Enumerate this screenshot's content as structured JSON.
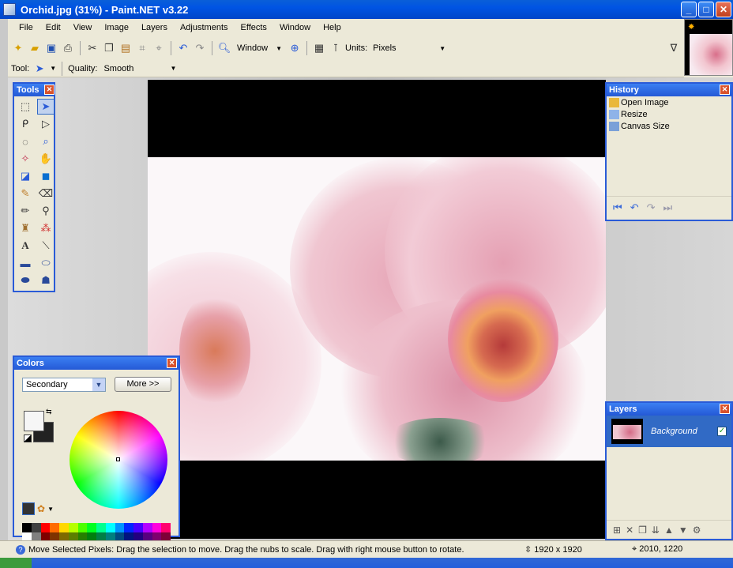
{
  "window": {
    "title": "Orchid.jpg (31%) - Paint.NET v3.22",
    "controls": [
      "minimize",
      "maximize",
      "close"
    ]
  },
  "menu": [
    "File",
    "Edit",
    "View",
    "Image",
    "Layers",
    "Adjustments",
    "Effects",
    "Window",
    "Help"
  ],
  "toolbar": {
    "zoom_value": "Window",
    "units_label": "Units:",
    "units_value": "Pixels",
    "tool_label": "Tool:",
    "quality_label": "Quality:",
    "quality_value": "Smooth"
  },
  "tools_panel": {
    "title": "Tools",
    "tools": [
      "rectangle-select",
      "move-selection",
      "lasso-select",
      "move-selected",
      "ellipse-select",
      "zoom",
      "magic-wand",
      "pan",
      "paint-bucket",
      "gradient",
      "paintbrush",
      "eraser",
      "pencil",
      "color-picker",
      "clone-stamp",
      "recolor",
      "text",
      "line-curve",
      "rectangle",
      "rounded-rectangle",
      "ellipse",
      "freeform-shape"
    ]
  },
  "history_panel": {
    "title": "History",
    "items": [
      "Open Image",
      "Resize",
      "Canvas Size"
    ]
  },
  "colors_panel": {
    "title": "Colors",
    "selector_value": "Secondary",
    "more_button": "More >>",
    "primary_color": "#f6f6f6",
    "secondary_color": "#222222"
  },
  "layers_panel": {
    "title": "Layers",
    "layers": [
      {
        "name": "Background",
        "visible": true
      }
    ]
  },
  "status": {
    "message": "Move Selected Pixels: Drag the selection to move. Drag the nubs to scale. Drag with right mouse button to rotate.",
    "image_size": "1920 x 1920",
    "cursor_pos": "2010, 1220"
  },
  "palette": [
    "#000000",
    "#404040",
    "#ff0000",
    "#ff6a00",
    "#ffd800",
    "#b6ff00",
    "#4cff00",
    "#00ff21",
    "#00ff90",
    "#00ffff",
    "#0094ff",
    "#0026ff",
    "#4800ff",
    "#b200ff",
    "#ff00dc",
    "#ff006e",
    "#ffffff",
    "#808080",
    "#7f0000",
    "#7f3300",
    "#7f6a00",
    "#5b7f00",
    "#267f00",
    "#007f0e",
    "#007f46",
    "#007f7f",
    "#004a7f",
    "#00137f",
    "#21007f",
    "#57007f",
    "#7f006e",
    "#7f0037"
  ]
}
